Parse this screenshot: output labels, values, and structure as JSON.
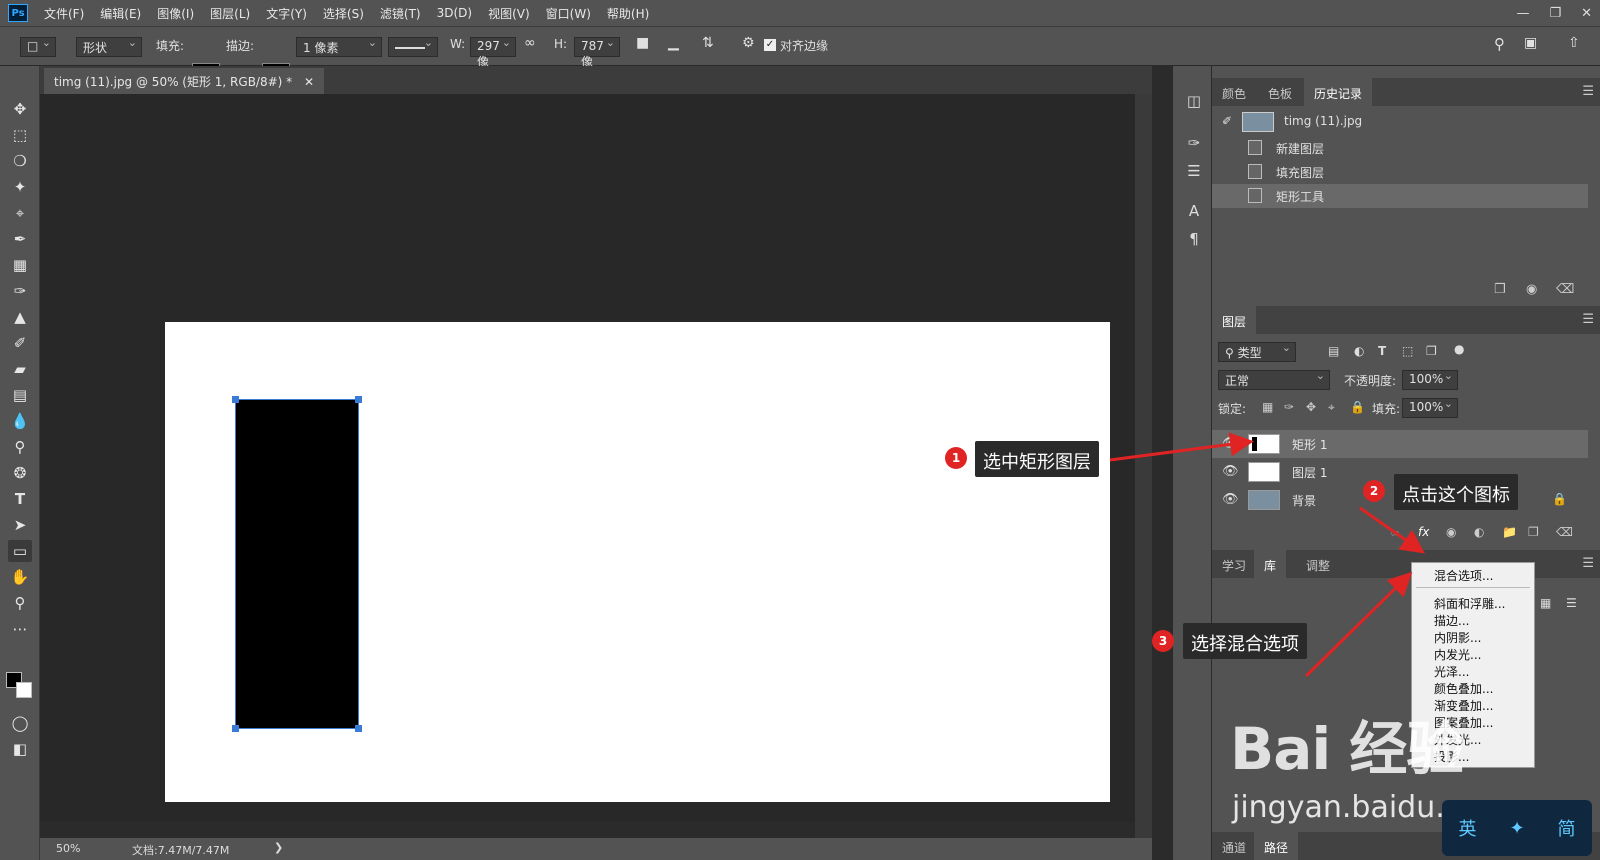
{
  "menubar": {
    "logo": "Ps",
    "items": [
      "文件(F)",
      "编辑(E)",
      "图像(I)",
      "图层(L)",
      "文字(Y)",
      "选择(S)",
      "滤镜(T)",
      "3D(D)",
      "视图(V)",
      "窗口(W)",
      "帮助(H)"
    ]
  },
  "options": {
    "mode": "形状",
    "fill_label": "填充:",
    "stroke_label": "描边:",
    "stroke_size": "1 像素",
    "w_label": "W:",
    "w_value": "297 像",
    "h_label": "H:",
    "h_value": "787 像",
    "align_edges": "对齐边缘"
  },
  "document": {
    "tab_title": "timg (11).jpg @ 50% (矩形 1, RGB/8#) *",
    "zoom": "50%",
    "doc_size": "文档:7.47M/7.47M"
  },
  "history_panel": {
    "tabs": [
      "颜色",
      "色板",
      "历史记录"
    ],
    "snapshot": "timg (11).jpg",
    "steps": [
      "新建图层",
      "填充图层",
      "矩形工具"
    ]
  },
  "layers_panel": {
    "tab": "图层",
    "filter": "类型",
    "blend_mode": "正常",
    "opacity_label": "不透明度:",
    "opacity": "100%",
    "lock_label": "锁定:",
    "fill_label": "填充:",
    "fill": "100%",
    "layers": [
      "矩形 1",
      "图层 1",
      "背景"
    ]
  },
  "fx_menu": {
    "items": [
      "混合选项...",
      "斜面和浮雕...",
      "描边...",
      "内阴影...",
      "内发光...",
      "光泽...",
      "颜色叠加...",
      "渐变叠加...",
      "图案叠加...",
      "外发光...",
      "投影..."
    ]
  },
  "lower_panel": {
    "tabs": [
      "学习",
      "库",
      "调整"
    ],
    "bottom_tabs": [
      "通道",
      "路径"
    ]
  },
  "annotations": {
    "step1": {
      "num": "1",
      "text": "选中矩形图层"
    },
    "step2": {
      "num": "2",
      "text": "点击这个图标"
    },
    "step3": {
      "num": "3",
      "text": "选择混合选项"
    }
  },
  "watermark": {
    "brand": "Bai 经验",
    "url": "jingyan.baidu.com",
    "ime": [
      "英",
      "简"
    ]
  },
  "colors": {
    "ui_bg": "#535353",
    "canvas_bg": "#282828",
    "selection": "#3a7bd5",
    "annotation_red": "#e02424"
  }
}
